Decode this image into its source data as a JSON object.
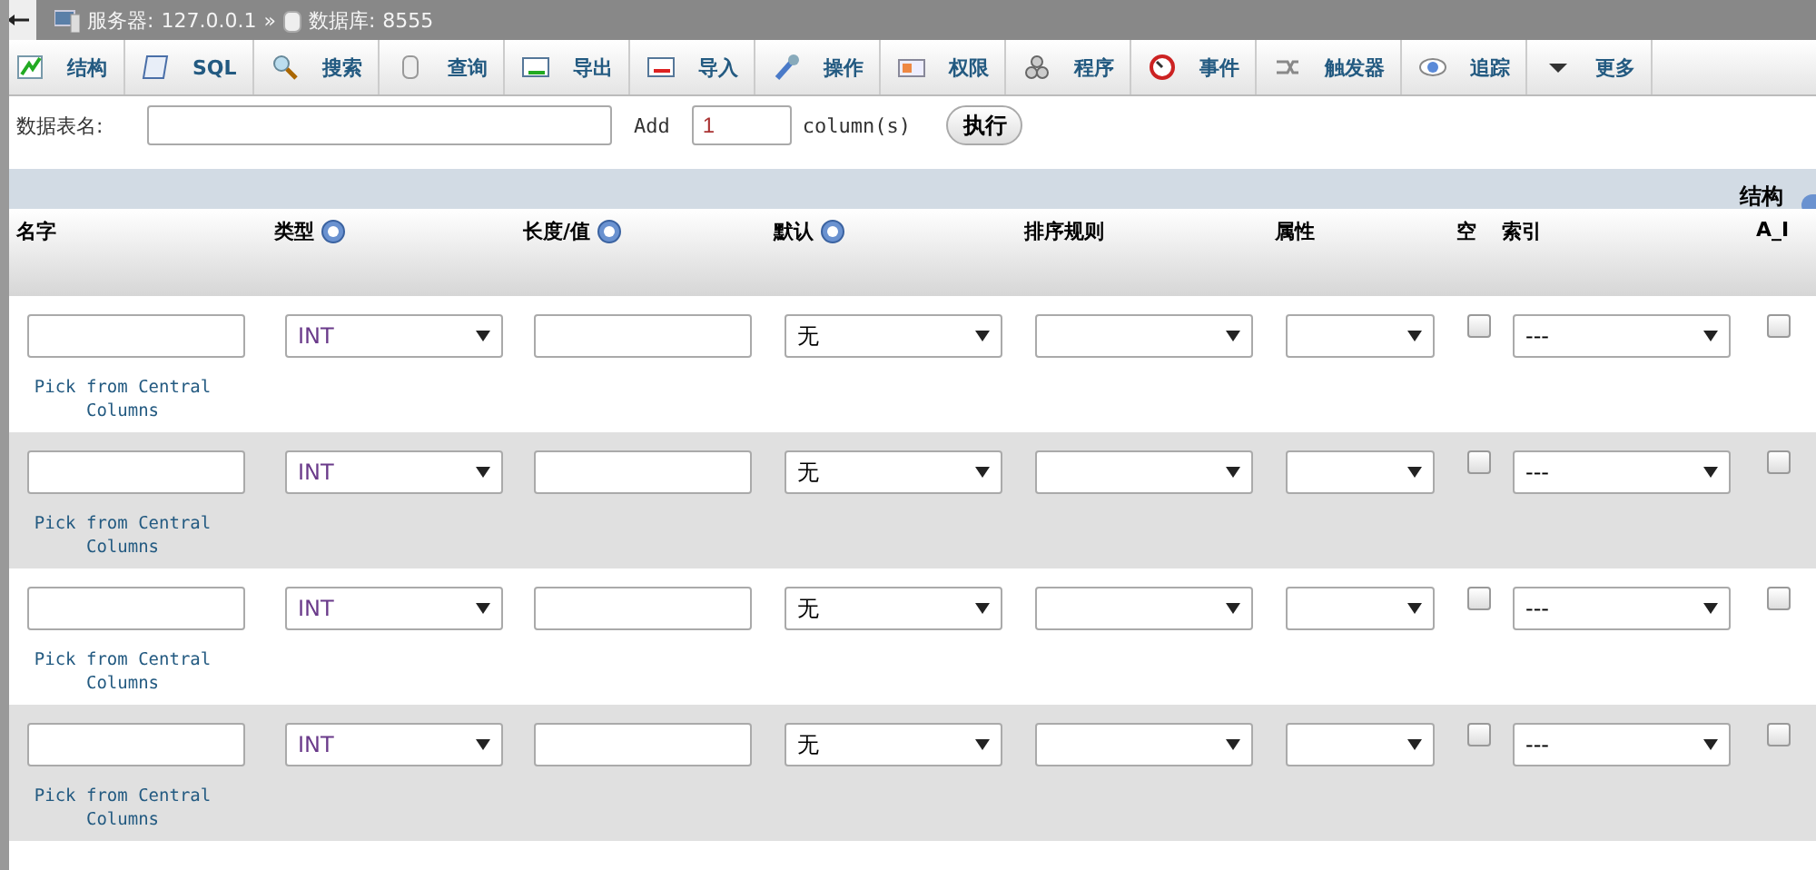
{
  "breadcrumb": {
    "server_label": "服务器:",
    "server": "127.0.0.1",
    "separator": "»",
    "database_label": "数据库:",
    "database": "8555"
  },
  "tabs": [
    {
      "label": "结构"
    },
    {
      "label": "SQL"
    },
    {
      "label": "搜索"
    },
    {
      "label": "查询"
    },
    {
      "label": "导出"
    },
    {
      "label": "导入"
    },
    {
      "label": "操作"
    },
    {
      "label": "权限"
    },
    {
      "label": "程序"
    },
    {
      "label": "事件"
    },
    {
      "label": "触发器"
    },
    {
      "label": "追踪"
    },
    {
      "label": "更多"
    }
  ],
  "form": {
    "table_name_label": "数据表名:",
    "add_label": "Add",
    "add_count": "1",
    "add_unit": "column(s)",
    "go_button": "执行"
  },
  "structure_label": "结构",
  "columns": [
    {
      "label": "名字",
      "help": false
    },
    {
      "label": "类型",
      "help": true
    },
    {
      "label": "长度/值",
      "help": true
    },
    {
      "label": "默认",
      "help": true
    },
    {
      "label": "排序规则",
      "help": false
    },
    {
      "label": "属性",
      "help": false
    },
    {
      "label": "空",
      "help": false
    },
    {
      "label": "索引",
      "help": false
    },
    {
      "label": "A_I",
      "help": false
    }
  ],
  "rows": [
    {
      "type": "INT",
      "default": "无",
      "index": "---",
      "null": false,
      "auto_increment": false,
      "link": "Pick from Central Columns"
    },
    {
      "type": "INT",
      "default": "无",
      "index": "---",
      "null": false,
      "auto_increment": false,
      "link": "Pick from Central Columns"
    },
    {
      "type": "INT",
      "default": "无",
      "index": "---",
      "null": false,
      "auto_increment": false,
      "link": "Pick from Central Columns"
    },
    {
      "type": "INT",
      "default": "无",
      "index": "---",
      "null": false,
      "auto_increment": false,
      "link": "Pick from Central Columns"
    }
  ]
}
